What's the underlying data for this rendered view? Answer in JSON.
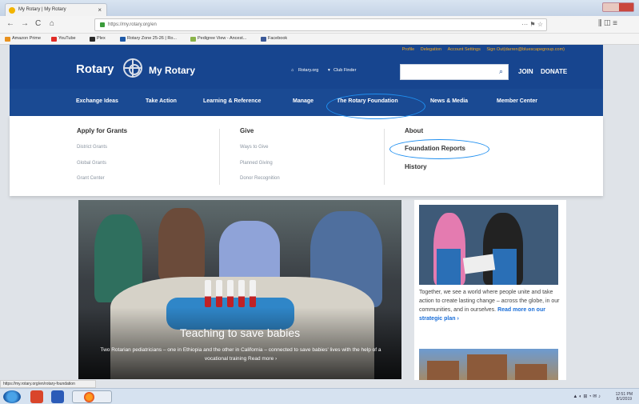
{
  "browser": {
    "tab_title": "My Rotary | My Rotary",
    "tab_close": "×",
    "url": "https://my.rotary.org/en",
    "back": "←",
    "forward": "→",
    "reload": "C",
    "home": "⌂",
    "url_icons": "··· ⚑ ☆",
    "right_icons": "⫼ ◫ ≡",
    "bookmarks": [
      {
        "label": "Amazon Prime",
        "color": "#e8911e"
      },
      {
        "label": "YouTube",
        "color": "#e12b26"
      },
      {
        "label": "Plex",
        "color": "#2a2a2a"
      },
      {
        "label": "Rotary Zone 25-26 | Ro...",
        "color": "#1f5aa8"
      },
      {
        "label": "Pedigree View - Ancest...",
        "color": "#8ab34a"
      },
      {
        "label": "Facebook",
        "color": "#3b5998"
      }
    ],
    "status_url": "https://my.rotary.org/en/rotary-foundation"
  },
  "header": {
    "top_links": [
      "Profile",
      "Delegation",
      "Account Settings",
      "Sign Out(darren@bluescapegroup.com)"
    ],
    "brand": "Rotary",
    "site": "My Rotary",
    "rotary_org": "Rotary.org",
    "club_finder": "Club Finder",
    "search_placeholder": "",
    "join": "JOIN",
    "donate": "DONATE"
  },
  "menu": [
    "Exchange Ideas",
    "Take Action",
    "Learning & Reference",
    "Manage",
    "The Rotary Foundation",
    "News & Media",
    "Member Center"
  ],
  "dropdown": {
    "col1": {
      "heading": "Apply for Grants",
      "links": [
        "District Grants",
        "Global Grants",
        "Grant Center"
      ]
    },
    "col2": {
      "heading": "Give",
      "links": [
        "Ways to Give",
        "Planned Giving",
        "Donor Recognition"
      ]
    },
    "col3": {
      "links": [
        "About",
        "Foundation Reports",
        "History"
      ]
    }
  },
  "hero": {
    "title": "Teaching to save babies",
    "subtitle": "Two Rotarian pediatricians – one in Ethiopia and the other in California – connected to save babies' lives with the help of a vocational training Read more ›"
  },
  "side": {
    "text": "Together, we see a world where people unite and take action to create lasting change – across the globe, in our communities, and in ourselves.",
    "link": "Read more on our strategic plan ›"
  },
  "taskbar": {
    "tray": "▲ ◐ ⊞ ◔ ✉ ♪",
    "time": "12:51 PM",
    "date": "8/1/2019"
  },
  "colors": {
    "rotary_blue": "#17458f",
    "rotary_gold": "#f7a81b",
    "highlight_oval": "#1f8ff0"
  }
}
